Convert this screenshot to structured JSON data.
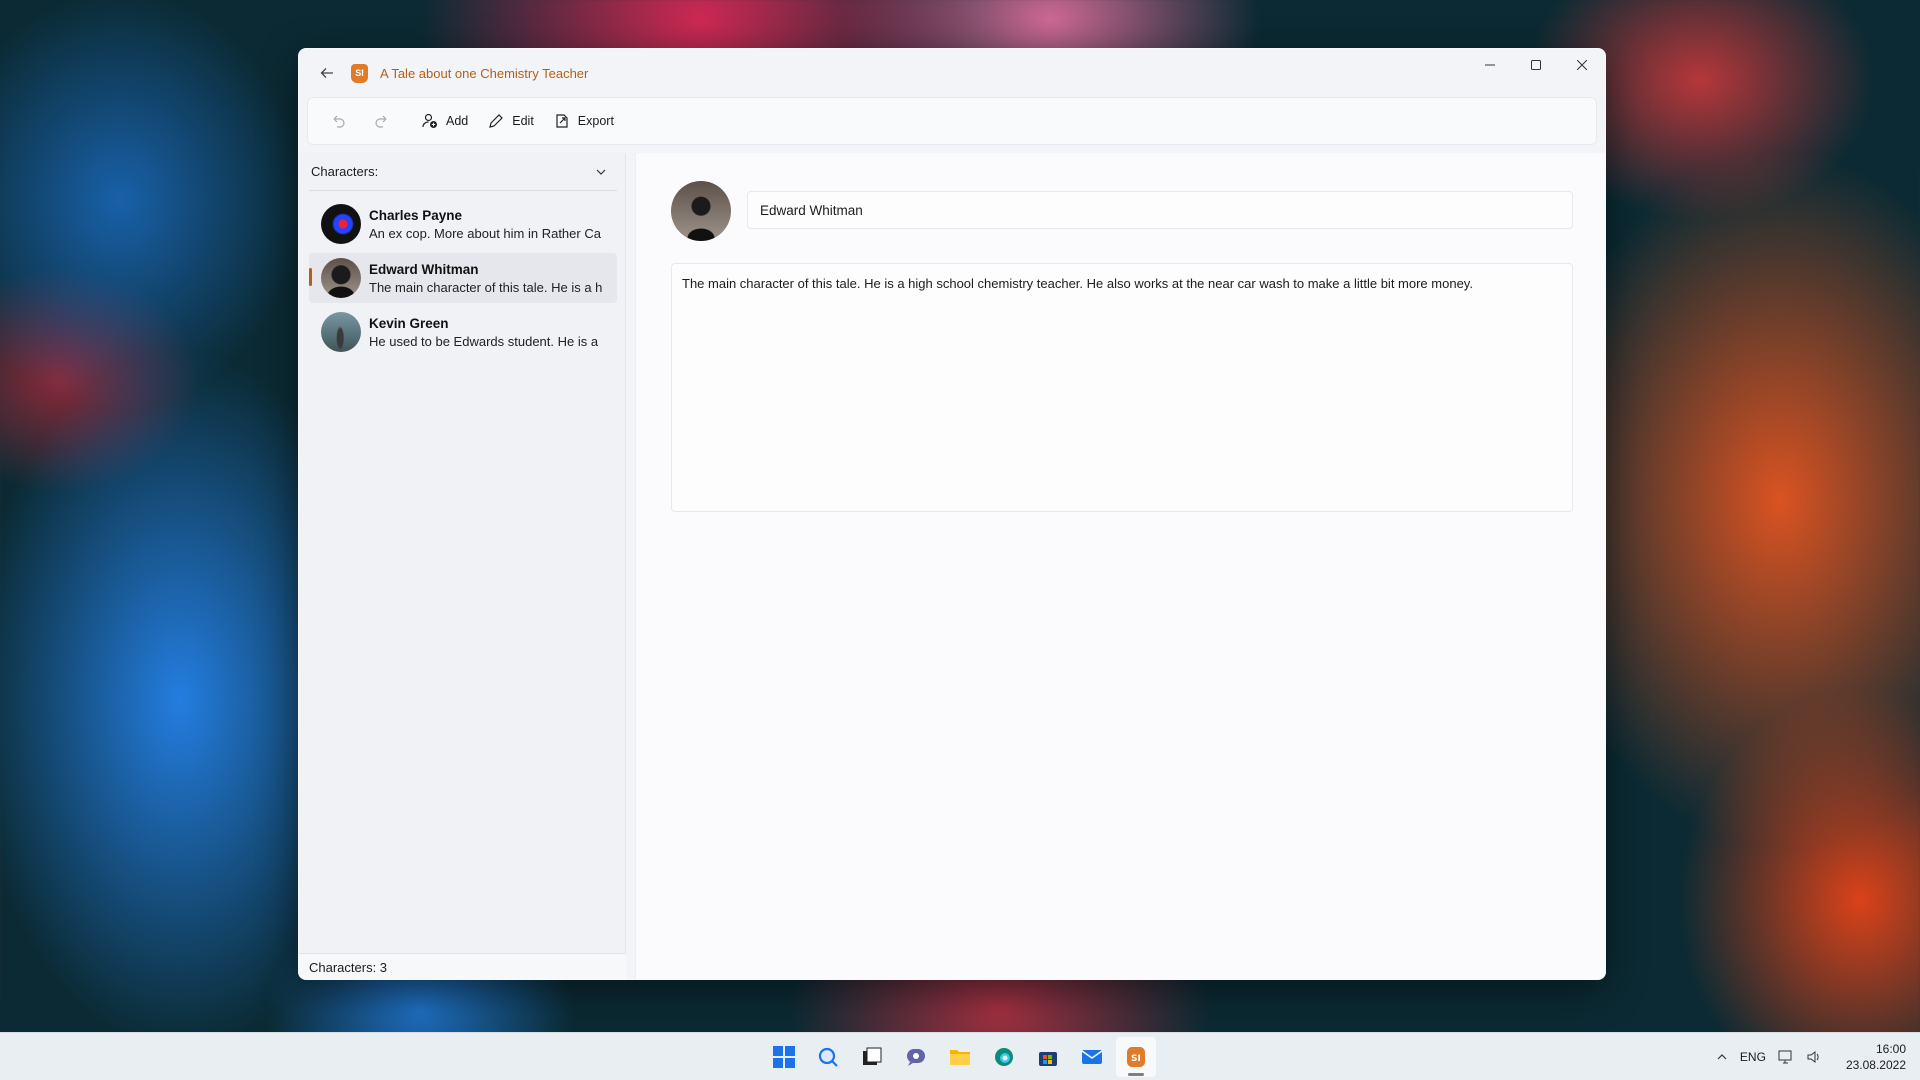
{
  "window": {
    "title": "A Tale about one Chemistry Teacher",
    "app_icon_text": "SI"
  },
  "toolbar": {
    "undo_icon": "undo-icon",
    "redo_icon": "redo-icon",
    "add_label": "Add",
    "edit_label": "Edit",
    "export_label": "Export"
  },
  "sidebar": {
    "dropdown_label": "Characters:",
    "characters": [
      {
        "name": "Charles Payne",
        "description": "An ex cop. More about him in Rather Ca"
      },
      {
        "name": "Edward Whitman",
        "description": "The main character of this tale. He is a h"
      },
      {
        "name": "Kevin Green",
        "description": "He used to be Edwards student. He is a"
      }
    ],
    "count_label": "Characters: 3"
  },
  "detail": {
    "name": "Edward Whitman",
    "description": "The main character of this tale. He is a high school chemistry teacher. He also works at the near car wash to make a little bit more money."
  },
  "taskbar": {
    "apps": [
      "start-icon",
      "search-icon",
      "task-view-icon",
      "chat-icon",
      "file-explorer-icon",
      "edge-icon",
      "store-icon",
      "mail-icon",
      "storyteller-app-icon"
    ],
    "language": "ENG",
    "time": "16:00",
    "date": "23.08.2022"
  },
  "colors": {
    "accent": "#b55f14",
    "app_icon": "#e07b2a"
  }
}
